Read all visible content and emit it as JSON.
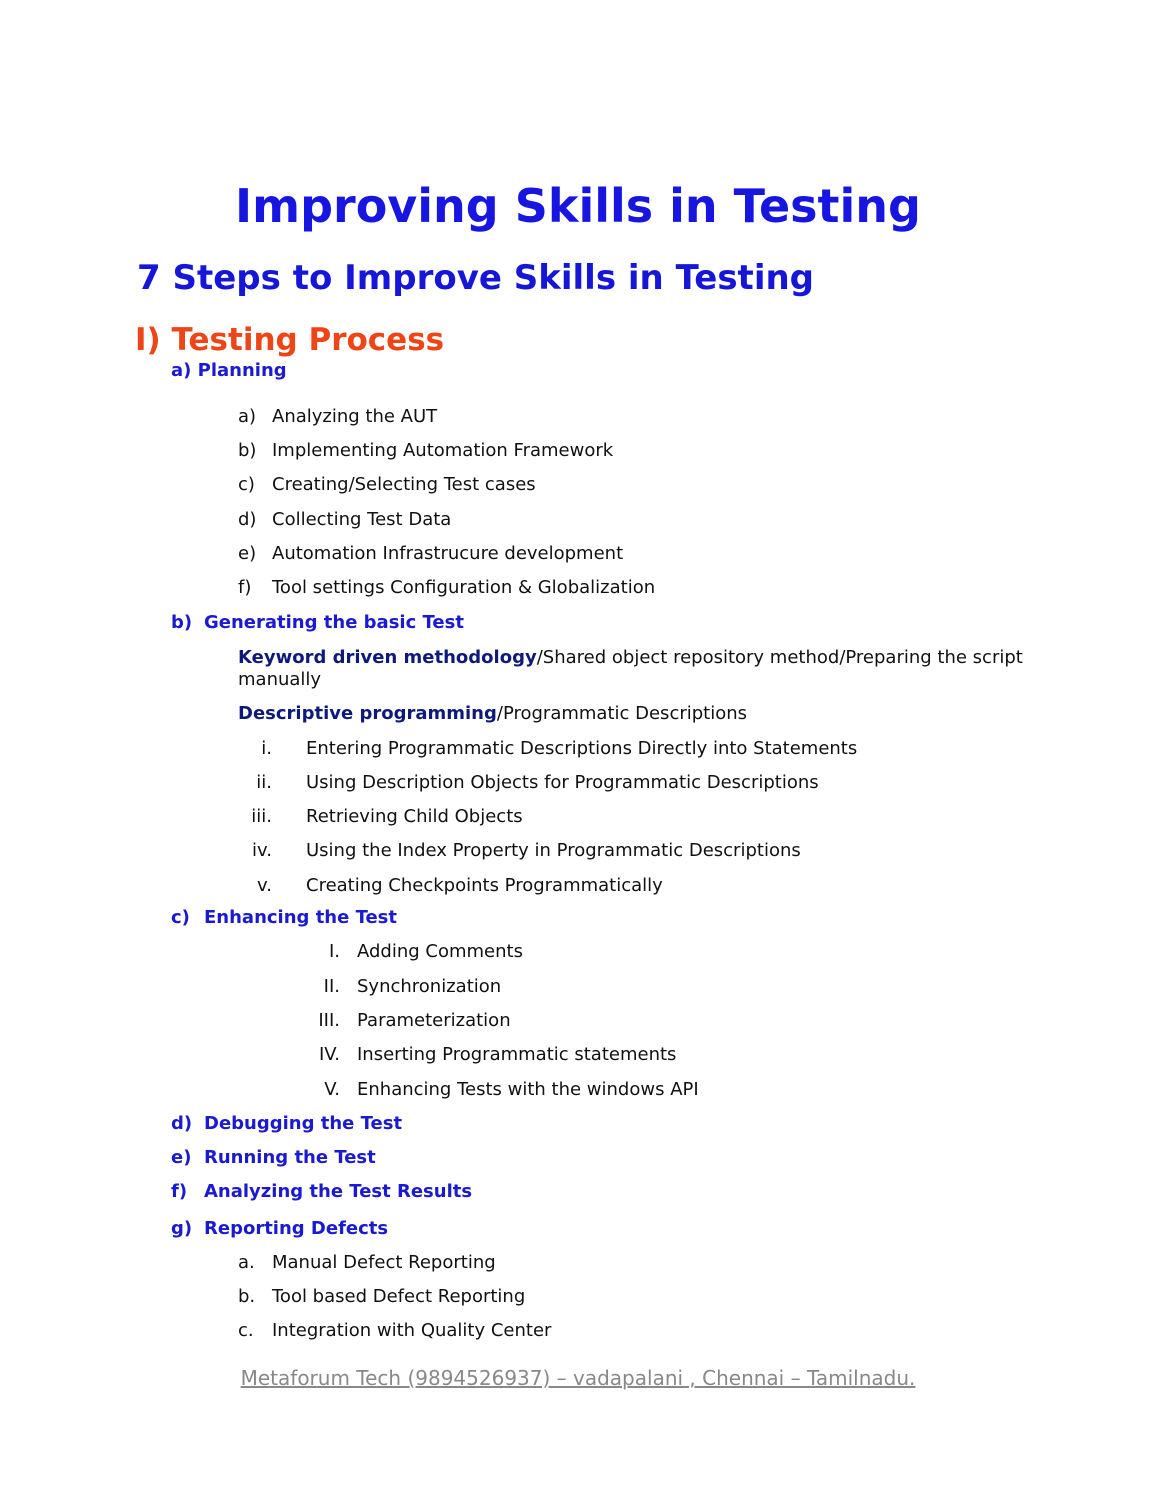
{
  "title": "Improving Skills in Testing",
  "subtitle": "7 Steps to Improve Skills in Testing",
  "section": {
    "label": "I) Testing Process"
  },
  "planning": {
    "label": "a) Planning",
    "items": [
      {
        "marker": "a)",
        "text": "Analyzing the AUT"
      },
      {
        "marker": "b)",
        "text": "Implementing Automation Framework"
      },
      {
        "marker": "c)",
        "text": "Creating/Selecting Test cases"
      },
      {
        "marker": "d)",
        "text": "Collecting Test Data"
      },
      {
        "marker": "e)",
        "text": "Automation Infrastrucure development"
      },
      {
        "marker": "f)",
        "text": "Tool settings Configuration & Globalization"
      }
    ]
  },
  "generating": {
    "marker": "b)",
    "label": "Generating the basic Test",
    "p1_bold": "Keyword driven methodology",
    "p1_rest": "/Shared object repository method/Preparing the script manually",
    "p2_bold": "Descriptive programming",
    "p2_rest": "/Programmatic Descriptions",
    "items": [
      {
        "marker": "i.",
        "text": "Entering Programmatic Descriptions Directly into Statements"
      },
      {
        "marker": "ii.",
        "text": "Using Description Objects for Programmatic Descriptions"
      },
      {
        "marker": "iii.",
        "text": "Retrieving Child Objects"
      },
      {
        "marker": "iv.",
        "text": "Using the Index Property in Programmatic Descriptions"
      },
      {
        "marker": "v.",
        "text": "Creating Checkpoints Programmatically"
      }
    ]
  },
  "enhancing": {
    "marker": "c)",
    "label": "Enhancing the Test",
    "items": [
      {
        "marker": "I.",
        "text": "Adding Comments"
      },
      {
        "marker": "II.",
        "text": "Synchronization"
      },
      {
        "marker": "III.",
        "text": "Parameterization"
      },
      {
        "marker": "IV.",
        "text": "Inserting Programmatic statements"
      },
      {
        "marker": "V.",
        "text": "Enhancing Tests with the windows API"
      }
    ]
  },
  "steps": [
    {
      "marker": "d)",
      "label": "Debugging the Test"
    },
    {
      "marker": "e)",
      "label": "Running the Test"
    },
    {
      "marker": "f)",
      "label": "Analyzing the Test Results"
    }
  ],
  "reporting": {
    "marker": "g)",
    "label": "Reporting Defects",
    "items": [
      {
        "marker": "a.",
        "text": "Manual Defect Reporting"
      },
      {
        "marker": "b.",
        "text": "Tool based Defect Reporting"
      },
      {
        "marker": "c.",
        "text": "Integration with Quality Center"
      }
    ]
  },
  "footer": "Metaforum Tech (9894526937) – vadapalani , Chennai – Tamilnadu."
}
